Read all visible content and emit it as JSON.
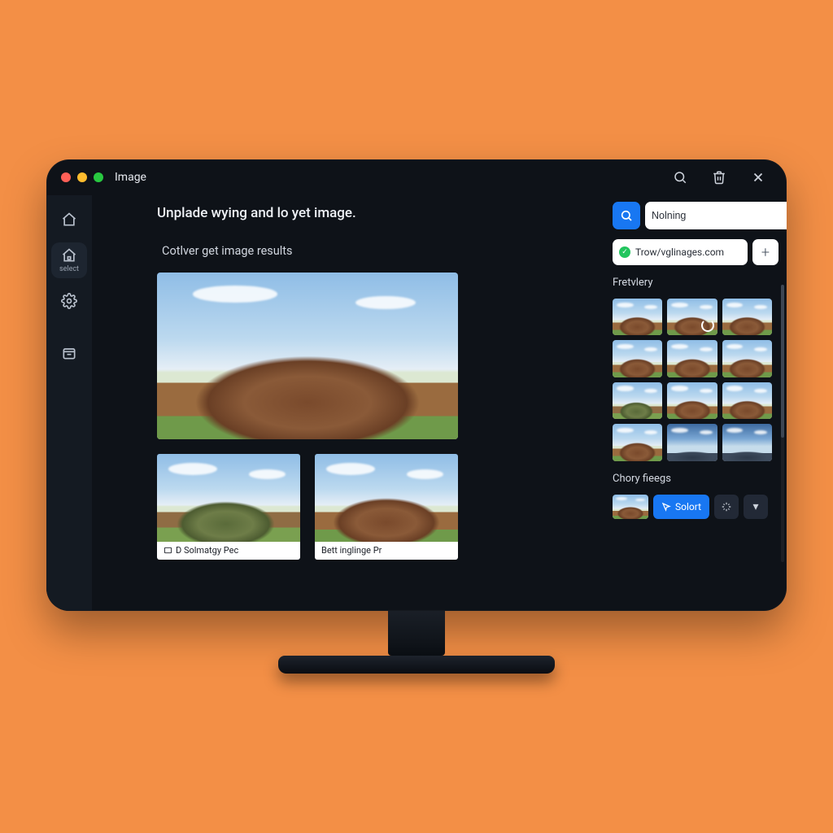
{
  "window": {
    "title": "Image"
  },
  "sidebar": {
    "items": [
      {
        "name": "home"
      },
      {
        "name": "select",
        "label": "select"
      },
      {
        "name": "settings"
      },
      {
        "name": "archive"
      }
    ]
  },
  "main": {
    "heading": "Unplade wying and lo yet image.",
    "subheading": "Cotlver get image results",
    "results": [
      {
        "caption": "D Solmatgy Pec"
      },
      {
        "caption": "Bett inglinge Pr"
      }
    ]
  },
  "panel": {
    "search_value": "Nolning",
    "url": "Trow/vglinages.com",
    "section1_label": "Fretvlery",
    "section2_label": "Chory fieegs",
    "select_label": "Solort"
  }
}
